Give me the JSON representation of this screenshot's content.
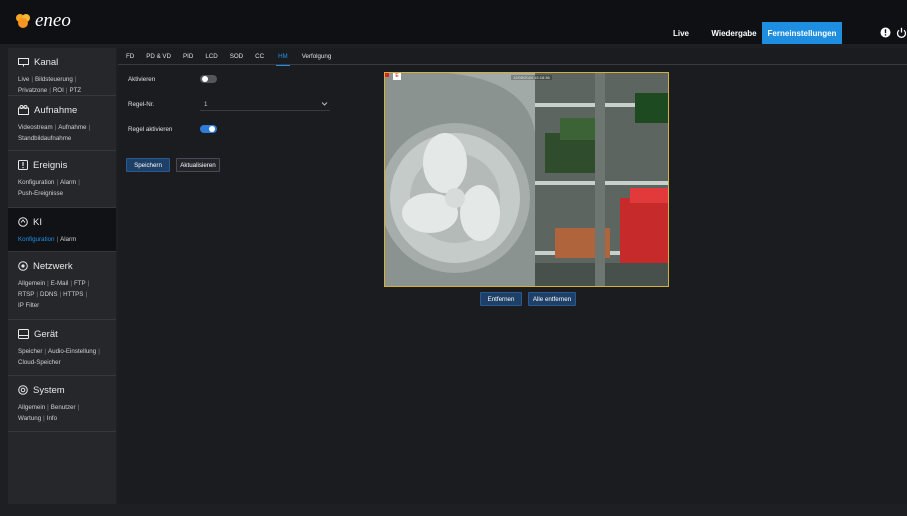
{
  "brand": {
    "name": "eneo",
    "accent": "#f5a623"
  },
  "topnav": {
    "live": "Live",
    "playback": "Wiedergabe",
    "remote": "Ferneinstellungen",
    "active_color": "#1e8fe0",
    "icons": [
      "info-icon",
      "power-icon"
    ]
  },
  "sidebar": {
    "sections": [
      {
        "title": "Kanal",
        "icon": "channel-icon",
        "links": [
          "Live",
          "Bildsteuerung",
          "Privatzone",
          "ROI",
          "PTZ"
        ]
      },
      {
        "title": "Aufnahme",
        "icon": "record-icon",
        "links": [
          "Videostream",
          "Aufnahme",
          "Standbildaufnahme"
        ]
      },
      {
        "title": "Ereignis",
        "icon": "event-icon",
        "links": [
          "Konfiguration",
          "Alarm",
          "Push-Ereignisse"
        ]
      },
      {
        "title": "KI",
        "icon": "ai-icon",
        "links": [
          "Konfiguration",
          "Alarm"
        ],
        "active": true,
        "active_link": "Konfiguration"
      },
      {
        "title": "Netzwerk",
        "icon": "network-icon",
        "links": [
          "Allgemein",
          "E-Mail",
          "FTP",
          "RTSP",
          "DDNS",
          "HTTPS",
          "IP Filter"
        ]
      },
      {
        "title": "Gerät",
        "icon": "device-icon",
        "links": [
          "Speicher",
          "Audio-Einstellung",
          "Cloud-Speicher"
        ]
      },
      {
        "title": "System",
        "icon": "system-icon",
        "links": [
          "Allgemein",
          "Benutzer",
          "Wartung",
          "Info"
        ]
      }
    ]
  },
  "tabs": {
    "items": [
      "FD",
      "PD & VD",
      "PID",
      "LCD",
      "SOD",
      "CC",
      "HM",
      "Verfolgung"
    ],
    "active": "HM"
  },
  "form": {
    "activate_label": "Aktivieren",
    "activate_on": false,
    "rule_no_label": "Regel-Nr.",
    "rule_no_value": "1",
    "rule_active_label": "Regel aktivieren",
    "rule_active_on": true,
    "save": "Speichern",
    "refresh": "Aktualisieren"
  },
  "video": {
    "timestamp": "12/05/2024 15:18:36",
    "remove": "Entfernen",
    "remove_all": "Alle entfernen"
  }
}
